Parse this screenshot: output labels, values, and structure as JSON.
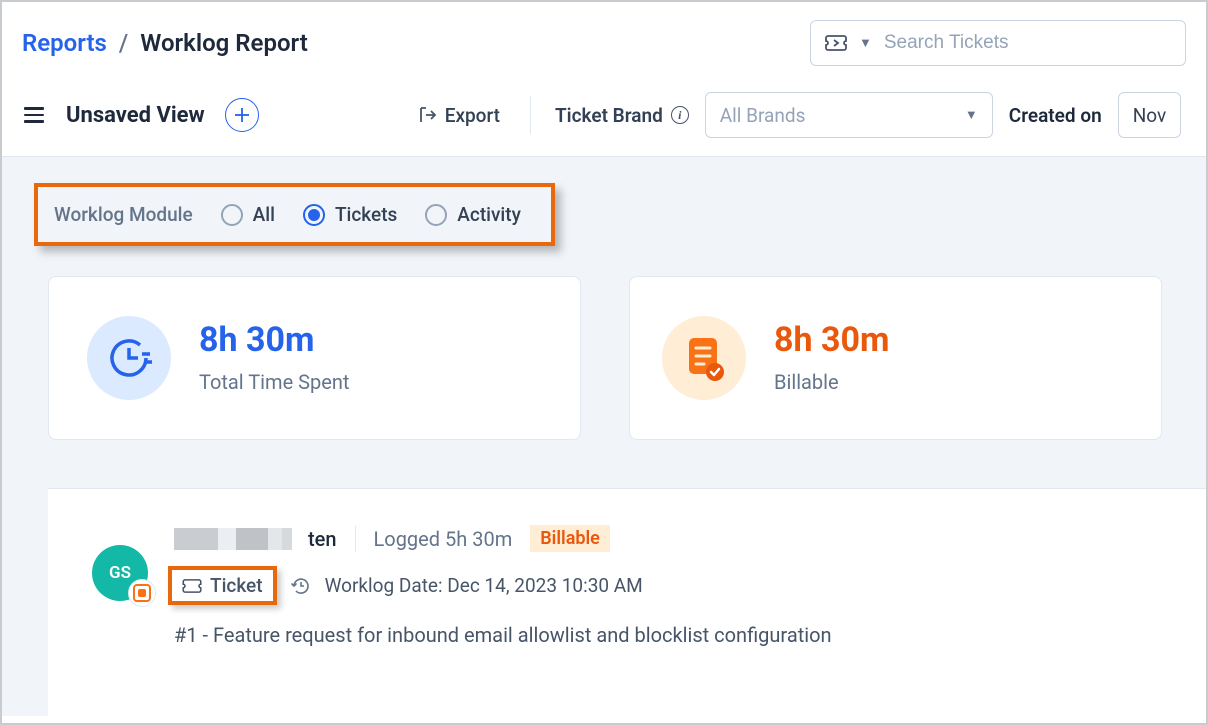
{
  "breadcrumb": {
    "parent": "Reports",
    "separator": "/",
    "current": "Worklog Report"
  },
  "search": {
    "placeholder": "Search Tickets"
  },
  "toolbar": {
    "view_title": "Unsaved View",
    "export_label": "Export",
    "brand_label": "Ticket Brand",
    "brand_value": "All Brands",
    "created_label": "Created on",
    "date_value": "Nov"
  },
  "module_filter": {
    "label": "Worklog Module",
    "options": [
      "All",
      "Tickets",
      "Activity"
    ],
    "selected": "Tickets"
  },
  "summary": {
    "total": {
      "value": "8h 30m",
      "label": "Total Time Spent"
    },
    "billable": {
      "value": "8h 30m",
      "label": "Billable"
    }
  },
  "log_entry": {
    "avatar_initials": "GS",
    "name_suffix": "ten",
    "logged_label": "Logged 5h 30m",
    "billable_chip": "Billable",
    "ticket_tag": "Ticket",
    "worklog_date": "Worklog Date: Dec 14, 2023 10:30 AM",
    "title": "#1 - Feature request for inbound email allowlist and blocklist configuration"
  },
  "colors": {
    "accent_blue": "#2563eb",
    "accent_orange": "#ea580c",
    "highlight_border": "#e8680c"
  }
}
